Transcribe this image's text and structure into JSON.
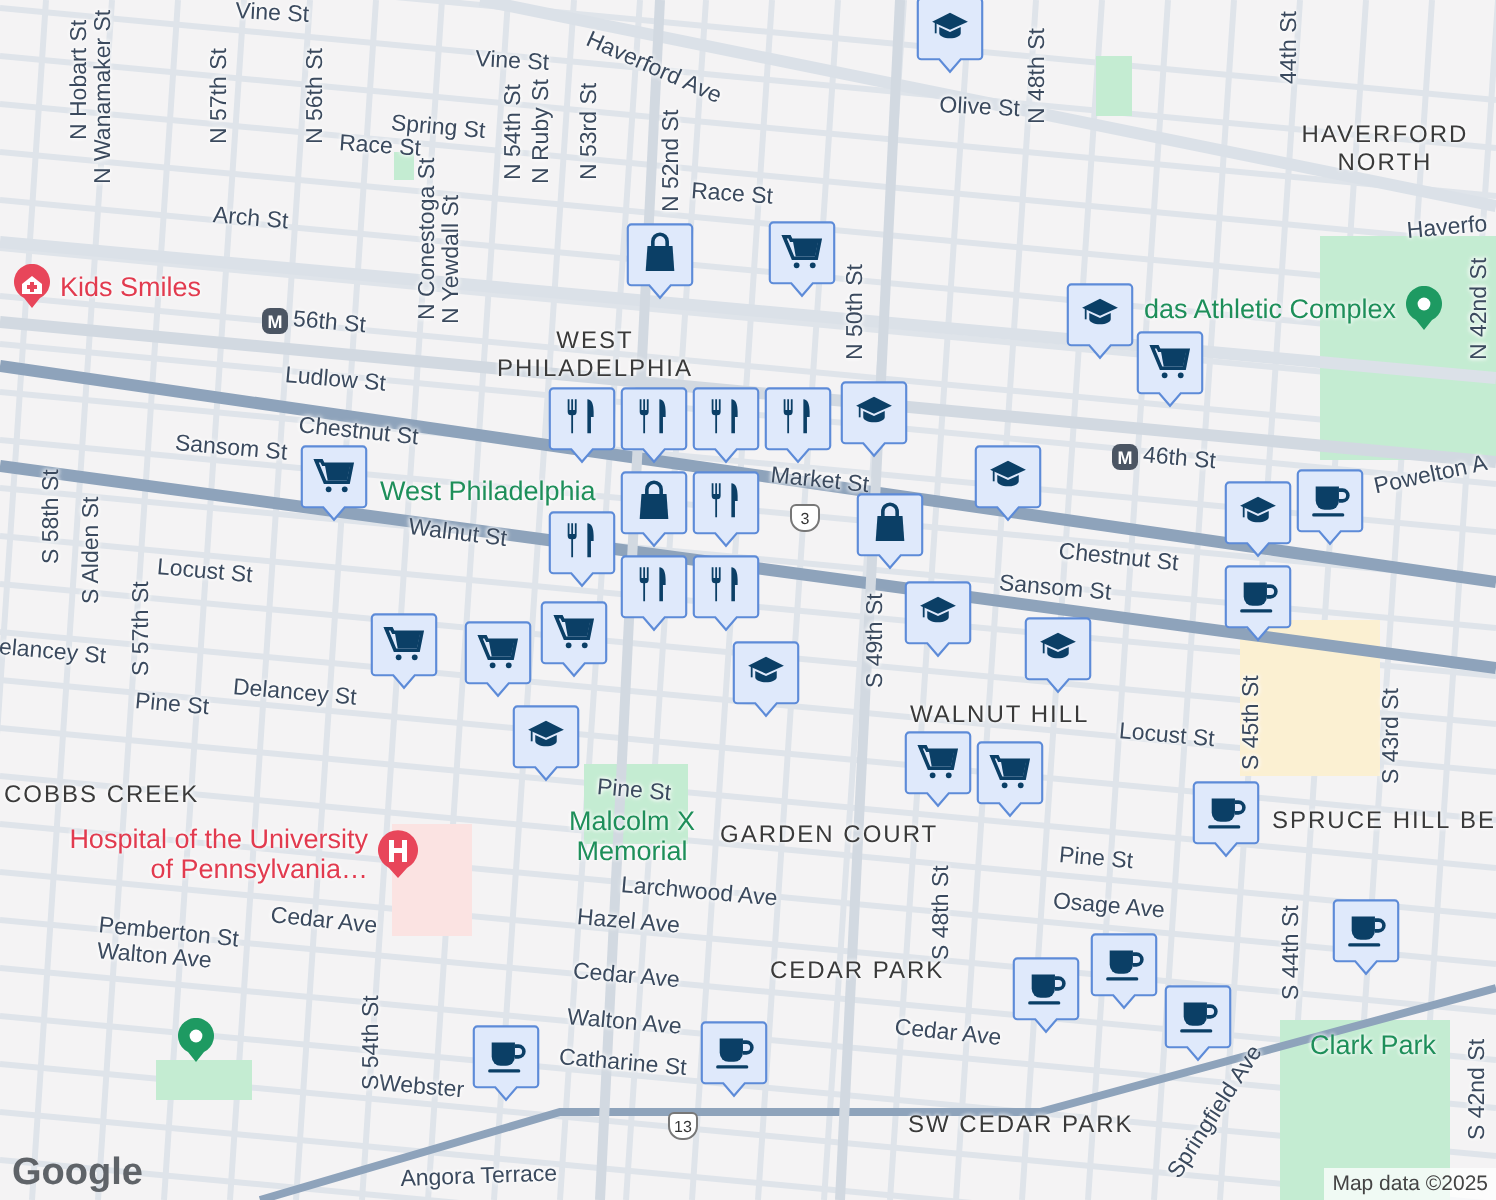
{
  "streets": [
    "Vine St",
    "Vine St",
    "Haverford Ave",
    "N Hobart St",
    "N Wanamaker St",
    "N 57th St",
    "N 56th St",
    "Spring St",
    "Race St",
    "N 54th St",
    "N Ruby St",
    "N 53rd St",
    "N 52nd St",
    "Race St",
    "Arch St",
    "N Conestoga St",
    "N Yewdall St",
    "Ludlow St",
    "Chestnut St",
    "Sansom St",
    "Walnut St",
    "Locust St",
    "Market St",
    "N 50th St",
    "N 48th St",
    "Olive St",
    "44th St",
    "Haverfo",
    "N 42nd St",
    "Powelton A",
    "Chestnut St",
    "Sansom St",
    "Locust St",
    "Delancey St",
    "Pine St",
    "elancey St",
    "S 57th St",
    "S 58th St",
    "S Alden St",
    "Pine St",
    "Larchwood Ave",
    "Hazel Ave",
    "Cedar Ave",
    "Cedar Ave",
    "Pemberton St",
    "Walton Ave",
    "Walton Ave",
    "Catharine St",
    "Webster",
    "S 54th St",
    "Angora Terrace",
    "Pine St",
    "Osage Ave",
    "Cedar Ave",
    "S 48th St",
    "S 49th St",
    "S 45th St",
    "S 43rd St",
    "S 44th St",
    "S 42nd St",
    "Springfield Ave"
  ],
  "neighborhoods": [
    "HAVERFORD NORTH",
    "WEST PHILADELPHIA",
    "WALNUT HILL",
    "COBBS CREEK",
    "GARDEN COURT",
    "SPRUCE HILL",
    "BE",
    "CEDAR PARK",
    "SW CEDAR PARK"
  ],
  "places": [
    {
      "name": "Kids Smiles",
      "kind": "clinic"
    },
    {
      "name": "das Athletic Complex",
      "kind": "park-pin"
    },
    {
      "name": "West Philadelphia",
      "kind": "park"
    },
    {
      "name": "Malcolm X Memorial",
      "kind": "park"
    },
    {
      "name": "Hospital of the University of Pennsylvania…",
      "kind": "hospital"
    },
    {
      "name": "Clark Park",
      "kind": "park"
    }
  ],
  "metro_stations": [
    {
      "label": "M",
      "name": "56th St"
    },
    {
      "label": "M",
      "name": "46th St"
    }
  ],
  "route_shields": [
    "3",
    "13"
  ],
  "pins": [
    {
      "kind": "school"
    },
    {
      "kind": "cart"
    },
    {
      "kind": "bag"
    },
    {
      "kind": "cart"
    },
    {
      "kind": "school"
    },
    {
      "kind": "cart"
    },
    {
      "kind": "school"
    },
    {
      "kind": "school"
    },
    {
      "kind": "bag"
    },
    {
      "kind": "school"
    },
    {
      "kind": "school"
    },
    {
      "kind": "school"
    },
    {
      "kind": "cafe"
    },
    {
      "kind": "cafe"
    },
    {
      "kind": "cart"
    },
    {
      "kind": "cart"
    },
    {
      "kind": "cart"
    },
    {
      "kind": "school"
    },
    {
      "kind": "school"
    },
    {
      "kind": "cart"
    },
    {
      "kind": "cart"
    },
    {
      "kind": "cafe"
    },
    {
      "kind": "cafe"
    },
    {
      "kind": "cafe"
    },
    {
      "kind": "cafe"
    },
    {
      "kind": "cafe"
    },
    {
      "kind": "cafe"
    },
    {
      "kind": "cafe"
    },
    {
      "kind": "food"
    },
    {
      "kind": "food"
    },
    {
      "kind": "bag"
    },
    {
      "kind": "food"
    },
    {
      "kind": "food"
    },
    {
      "kind": "food"
    },
    {
      "kind": "food"
    },
    {
      "kind": "food"
    },
    {
      "kind": "food"
    }
  ],
  "logo": "Google",
  "attribution": "Map data ©2025"
}
